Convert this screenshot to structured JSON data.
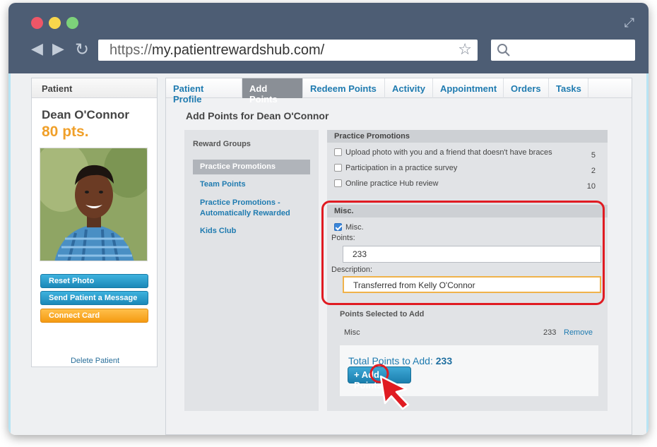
{
  "browser": {
    "url_scheme": "https://",
    "url_host": "my.patientrewardshub.com/"
  },
  "sidebar": {
    "header": "Patient",
    "name": "Dean O'Connor",
    "points": "80 pts.",
    "buttons": [
      "Reset Photo",
      "Send Patient a Message",
      "Connect Card"
    ],
    "delete_label": "Delete Patient"
  },
  "tabs": [
    "Patient Profile",
    "Add Points",
    "Redeem Points",
    "Activity",
    "Appointment",
    "Orders",
    "Tasks"
  ],
  "active_tab": "Add Points",
  "main": {
    "title": "Add Points for Dean O'Connor"
  },
  "reward_groups": {
    "header": "Reward Groups",
    "items": [
      "Practice Promotions",
      "Team Points",
      "Practice Promotions - Automatically Rewarded",
      "Kids Club"
    ],
    "selected": "Practice Promotions"
  },
  "practice_promotions": {
    "header": "Practice Promotions",
    "items": [
      {
        "label": "Upload photo with you and a friend that doesn't have braces",
        "points": "5"
      },
      {
        "label": "Participation in a practice survey",
        "points": "2"
      },
      {
        "label": "Online practice Hub review",
        "points": "10"
      }
    ]
  },
  "misc": {
    "header": "Misc.",
    "checkbox_label": "Misc.",
    "points_label": "Points:",
    "points_value": "233",
    "description_label": "Description:",
    "description_value": "Transferred from Kelly O'Connor"
  },
  "selected": {
    "header": "Points Selected to Add",
    "row_name": "Misc",
    "row_points": "233",
    "remove_label": "Remove",
    "total_label": "Total Points to Add:",
    "total_value": "233",
    "add_button": "+ Add Points"
  },
  "colors": {
    "chrome": "#4d5d74",
    "link": "#1f7bb0",
    "points": "#f0a02a",
    "highlight": "#e01b22"
  }
}
